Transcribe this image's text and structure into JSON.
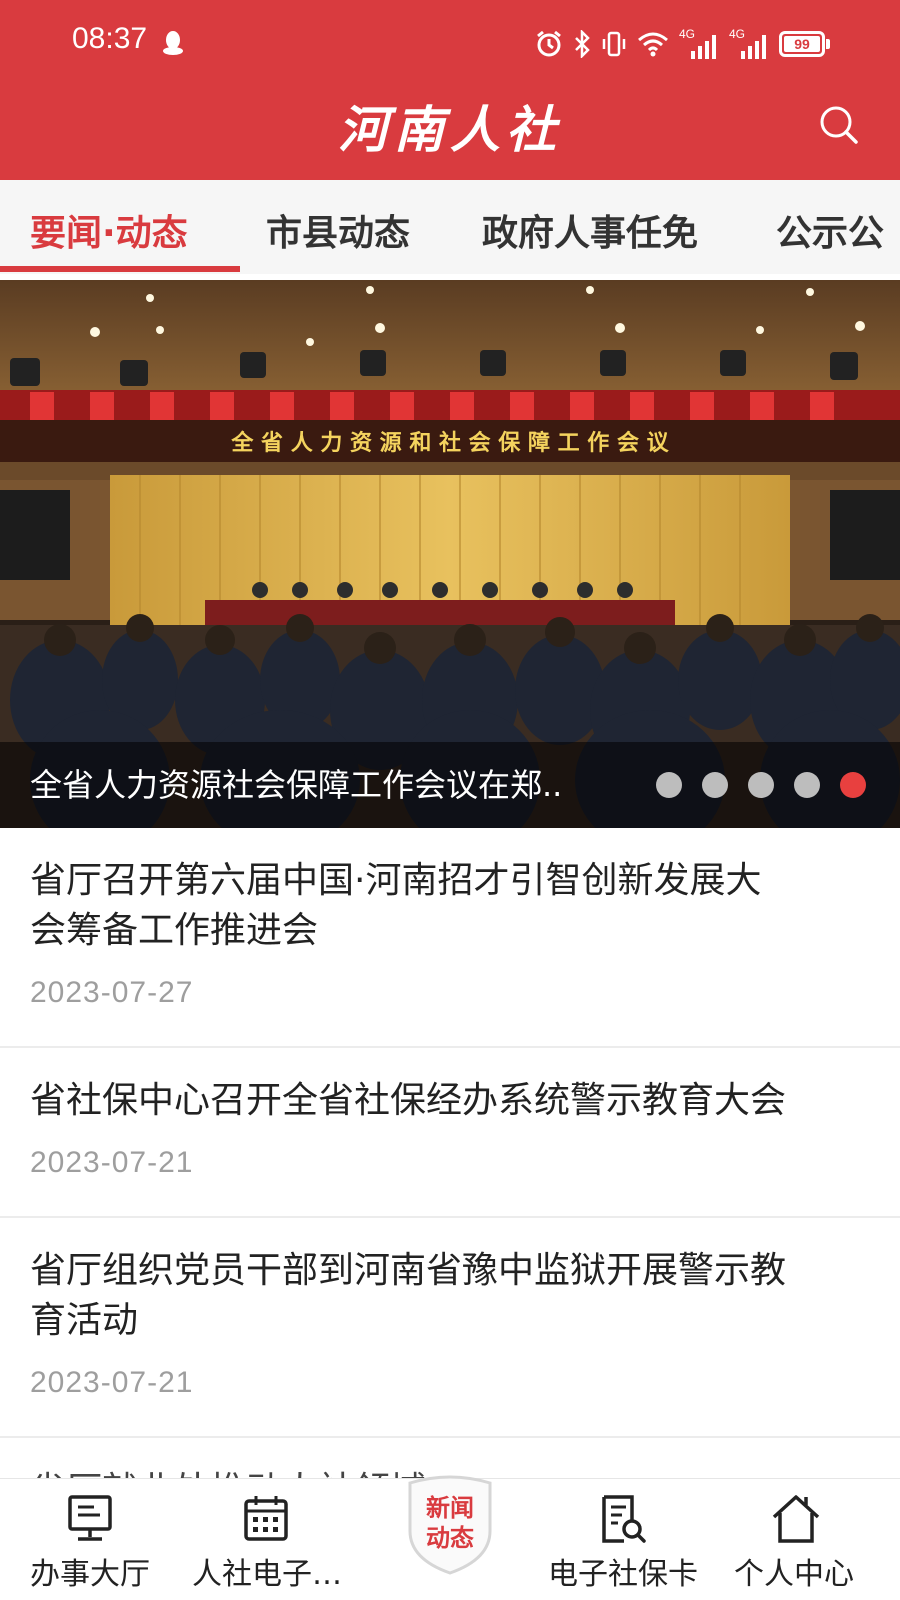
{
  "status_bar": {
    "time": "08:37",
    "network_1": "4G",
    "network_2": "4G",
    "battery": "99"
  },
  "header": {
    "title": "河南人社",
    "search_icon": "search-icon"
  },
  "tabs": [
    {
      "label": "要闻·动态",
      "active": true
    },
    {
      "label": "市县动态",
      "active": false
    },
    {
      "label": "政府人事任免",
      "active": false
    },
    {
      "label": "公示公",
      "active": false
    }
  ],
  "banner": {
    "caption": "全省人力资源社会保障工作会议在郑..",
    "stage_banner_text": "全 省 人 力 资 源 和 社 会 保 障 工 作 会 议",
    "slide_count": 5,
    "active_slide": 5
  },
  "news": [
    {
      "title_line1": "省厅召开第六届中国·河南招才引智创新发展大",
      "title_line2": "会筹备工作推进会",
      "date": "2023-07-27"
    },
    {
      "title_line1": "省社保中心召开全省社保经办系统警示教育大会",
      "title_line2": "",
      "date": "2023-07-21"
    },
    {
      "title_line1": "省厅组织党员干部到河南省豫中监狱开展警示教",
      "title_line2": "育活动",
      "date": "2023-07-21"
    },
    {
      "title_line1": "省厅就业处推动人社领域…",
      "title_line2": "",
      "date": ""
    }
  ],
  "bottom_nav": {
    "items": [
      {
        "label": "办事大厅",
        "icon": "monitor-icon"
      },
      {
        "label": "人社电子…",
        "icon": "calendar-grid-icon"
      },
      {
        "label": "新闻\n动态",
        "line1": "新闻",
        "line2": "动态",
        "icon": "shield-badge-icon"
      },
      {
        "label": "电子社保卡",
        "icon": "document-search-icon"
      },
      {
        "label": "个人中心",
        "icon": "home-icon"
      }
    ]
  },
  "colors": {
    "brand": "#d93b3f",
    "tab_background": "#f6f6f6",
    "date_text": "#9e9e9e"
  }
}
